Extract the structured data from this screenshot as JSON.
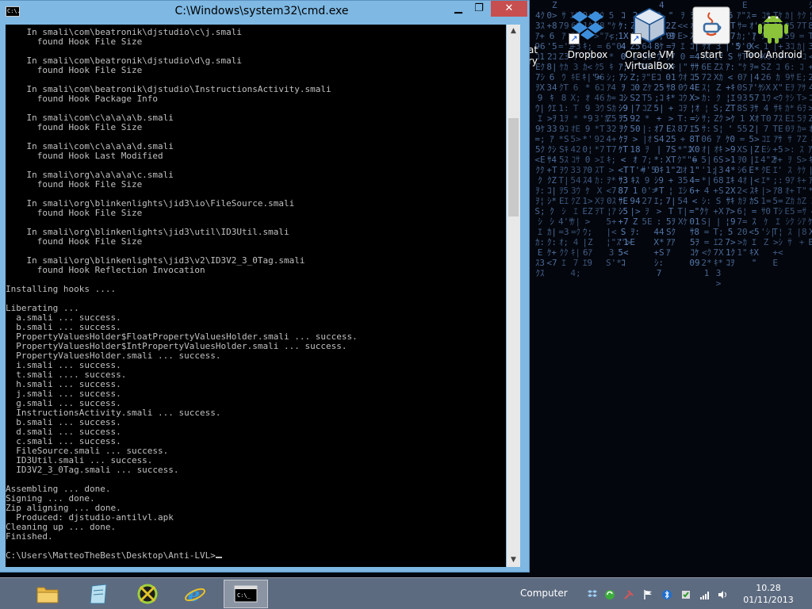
{
  "window": {
    "title": "C:\\Windows\\system32\\cmd.exe",
    "icon_label": "C:\\.",
    "min_label": "▁",
    "max_label": "❐",
    "close_label": "✕"
  },
  "console": {
    "lines": [
      "    In smali\\com\\beatronik\\djstudio\\c\\j.smali",
      "      found Hook File Size",
      "",
      "    In smali\\com\\beatronik\\djstudio\\d\\g.smali",
      "      found Hook File Size",
      "",
      "    In smali\\com\\beatronik\\djstudio\\InstructionsActivity.smali",
      "      found Hook Package Info",
      "",
      "    In smali\\com\\c\\a\\a\\a\\b.smali",
      "      found Hook File Size",
      "",
      "    In smali\\com\\c\\a\\a\\a\\d.smali",
      "      found Hook Last Modified",
      "",
      "    In smali\\org\\a\\a\\a\\a\\c.smali",
      "      found Hook File Size",
      "",
      "    In smali\\org\\blinkenlights\\jid3\\io\\FileSource.smali",
      "      found Hook File Size",
      "",
      "    In smali\\org\\blinkenlights\\jid3\\util\\ID3Util.smali",
      "      found Hook File Size",
      "",
      "    In smali\\org\\blinkenlights\\jid3\\v2\\ID3V2_3_0Tag.smali",
      "      found Hook Reflection Invocation",
      "",
      "Installing hooks ....",
      "",
      "Liberating ...",
      "  a.smali ... success.",
      "  b.smali ... success.",
      "  PropertyValuesHolder$FloatPropertyValuesHolder.smali ... success.",
      "  PropertyValuesHolder$IntPropertyValuesHolder.smali ... success.",
      "  PropertyValuesHolder.smali ... success.",
      "  i.smali ... success.",
      "  t.smali .... success.",
      "  h.smali ... success.",
      "  j.smali ... success.",
      "  g.smali ... success.",
      "  InstructionsActivity.smali ... success.",
      "  b.smali ... success.",
      "  d.smali ... success.",
      "  c.smali ... success.",
      "  FileSource.smali ... success.",
      "  ID3Util.smali ... success.",
      "  ID3V2_3_0Tag.smali ... success.",
      "",
      "Assembling ... done.",
      "Signing ... done.",
      "Zip aligning ... done.",
      "  Produced: djstudio-antilvl.apk",
      "Cleaning up ... done.",
      "Finished.",
      ""
    ],
    "prompt": "C:\\Users\\MatteoTheBest\\Desktop\\Anti-LVL>"
  },
  "desktop": {
    "partial_icon_label": [
      "at",
      "ry"
    ],
    "icons": [
      {
        "label": "Dropbox",
        "icon": "dropbox-icon"
      },
      {
        "label": "Oracle VM VirtualBox",
        "icon": "virtualbox-icon"
      },
      {
        "label": "start",
        "icon": "java-icon"
      },
      {
        "label": "Tool Android",
        "icon": "android-icon"
      }
    ]
  },
  "taskbar": {
    "apps": [
      {
        "name": "file-explorer",
        "icon": "folder-icon"
      },
      {
        "name": "notepad",
        "icon": "notepad-icon"
      },
      {
        "name": "app-green",
        "icon": "green-app-icon"
      },
      {
        "name": "internet-explorer",
        "icon": "ie-icon"
      },
      {
        "name": "cmd",
        "icon": "cmd-icon",
        "active": true
      }
    ],
    "computer_label": "Computer",
    "clock": {
      "time": "10.28",
      "date": "01/11/2013"
    }
  },
  "colors": {
    "console_text": "#c0c0c0",
    "titlebar": "#7eb8e3",
    "close_button": "#c74f4f",
    "taskbar": "#5d6b80",
    "matrix_glyph": "#5f86c0"
  }
}
